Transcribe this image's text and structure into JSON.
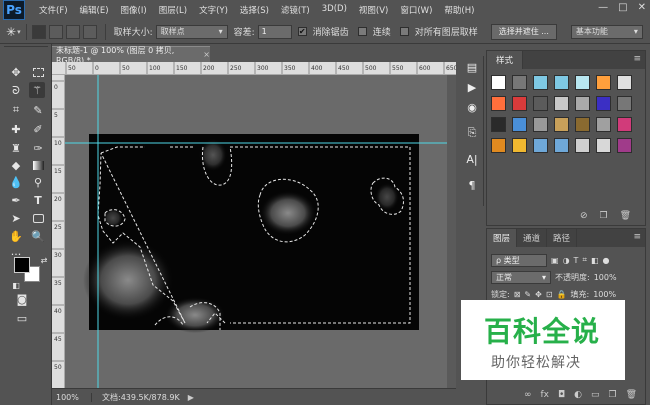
{
  "app": {
    "logo": "Ps"
  },
  "menu": [
    "文件(F)",
    "编辑(E)",
    "图像(I)",
    "图层(L)",
    "文字(Y)",
    "选择(S)",
    "滤镜(T)",
    "3D(D)",
    "视图(V)",
    "窗口(W)",
    "帮助(H)"
  ],
  "window_controls": {
    "minimize": "—",
    "restore": "□",
    "close": "✕"
  },
  "options": {
    "tool_icon": "magic-wand-icon",
    "sample_size_label": "取样大小:",
    "sample_size_value": "取样点",
    "tolerance_label": "容差:",
    "tolerance_value": "1",
    "antialias_label": "消除锯齿",
    "antialias_checked": true,
    "contiguous_label": "连续",
    "contiguous_checked": false,
    "sample_all_label": "对所有图层取样",
    "sample_all_checked": false,
    "select_mask_button": "选择并遮住 ...",
    "workspace_value": "基本功能"
  },
  "document": {
    "tab_title": "未标题-1 @ 100% (图层 0 拷贝, RGB/8) *",
    "tab_close": "×",
    "ruler_top_labels": [
      "50",
      "0",
      "50",
      "100",
      "150",
      "200",
      "250",
      "300",
      "350",
      "400",
      "450",
      "500",
      "550",
      "600",
      "650"
    ],
    "ruler_left_labels": [
      "0",
      "5",
      "10",
      "15",
      "20",
      "25",
      "30",
      "35",
      "40",
      "45",
      "50"
    ],
    "zoom": "100%",
    "status": "文档:439.5K/878.9K",
    "guide_color": "#4fd8e6"
  },
  "toolbox": {
    "tools": [
      "move-icon",
      "marquee-icon",
      "lasso-icon",
      "magic-wand-icon",
      "crop-icon",
      "eyedropper-icon",
      "healing-icon",
      "brush-icon",
      "stamp-icon",
      "history-brush-icon",
      "eraser-icon",
      "gradient-icon",
      "blur-icon",
      "dodge-icon",
      "pen-icon",
      "type-icon",
      "path-select-icon",
      "shape-icon",
      "hand-icon",
      "zoom-icon"
    ],
    "foreground_color": "#000000",
    "background_color": "#ffffff"
  },
  "styles_panel": {
    "tab_label": "样式",
    "swatches": [
      "#ffffff",
      "#777777",
      "#7ec8e3",
      "#7ec8e3",
      "#b8e6f0",
      "#ff9f3c",
      "#e0e0e0",
      "#ff6f3c",
      "#d93b3b",
      "#5b5b5b",
      "#c8c8c8",
      "#aaaaaa",
      "#3b2fc4",
      "#777777",
      "#2a2a2a",
      "#4a8fd8",
      "#999999",
      "#c8a05a",
      "#8a6a30",
      "#a0a0a0",
      "#d13b7a",
      "#e08a20",
      "#f0b830",
      "#6fa8d8",
      "#6fa8d8",
      "#cfcfcf",
      "#d8d8d8",
      "#a03b8a"
    ]
  },
  "layers_panel": {
    "tabs": [
      "图层",
      "通道",
      "路径"
    ],
    "filter_label": "ρ 类型",
    "blend_mode": "正常",
    "opacity_label": "不透明度:",
    "opacity_value": "100%",
    "lock_label": "锁定:",
    "fill_label": "填充:",
    "fill_value": "100%"
  },
  "watermark": {
    "main": "百科全说",
    "sub": "助你轻松解决"
  }
}
